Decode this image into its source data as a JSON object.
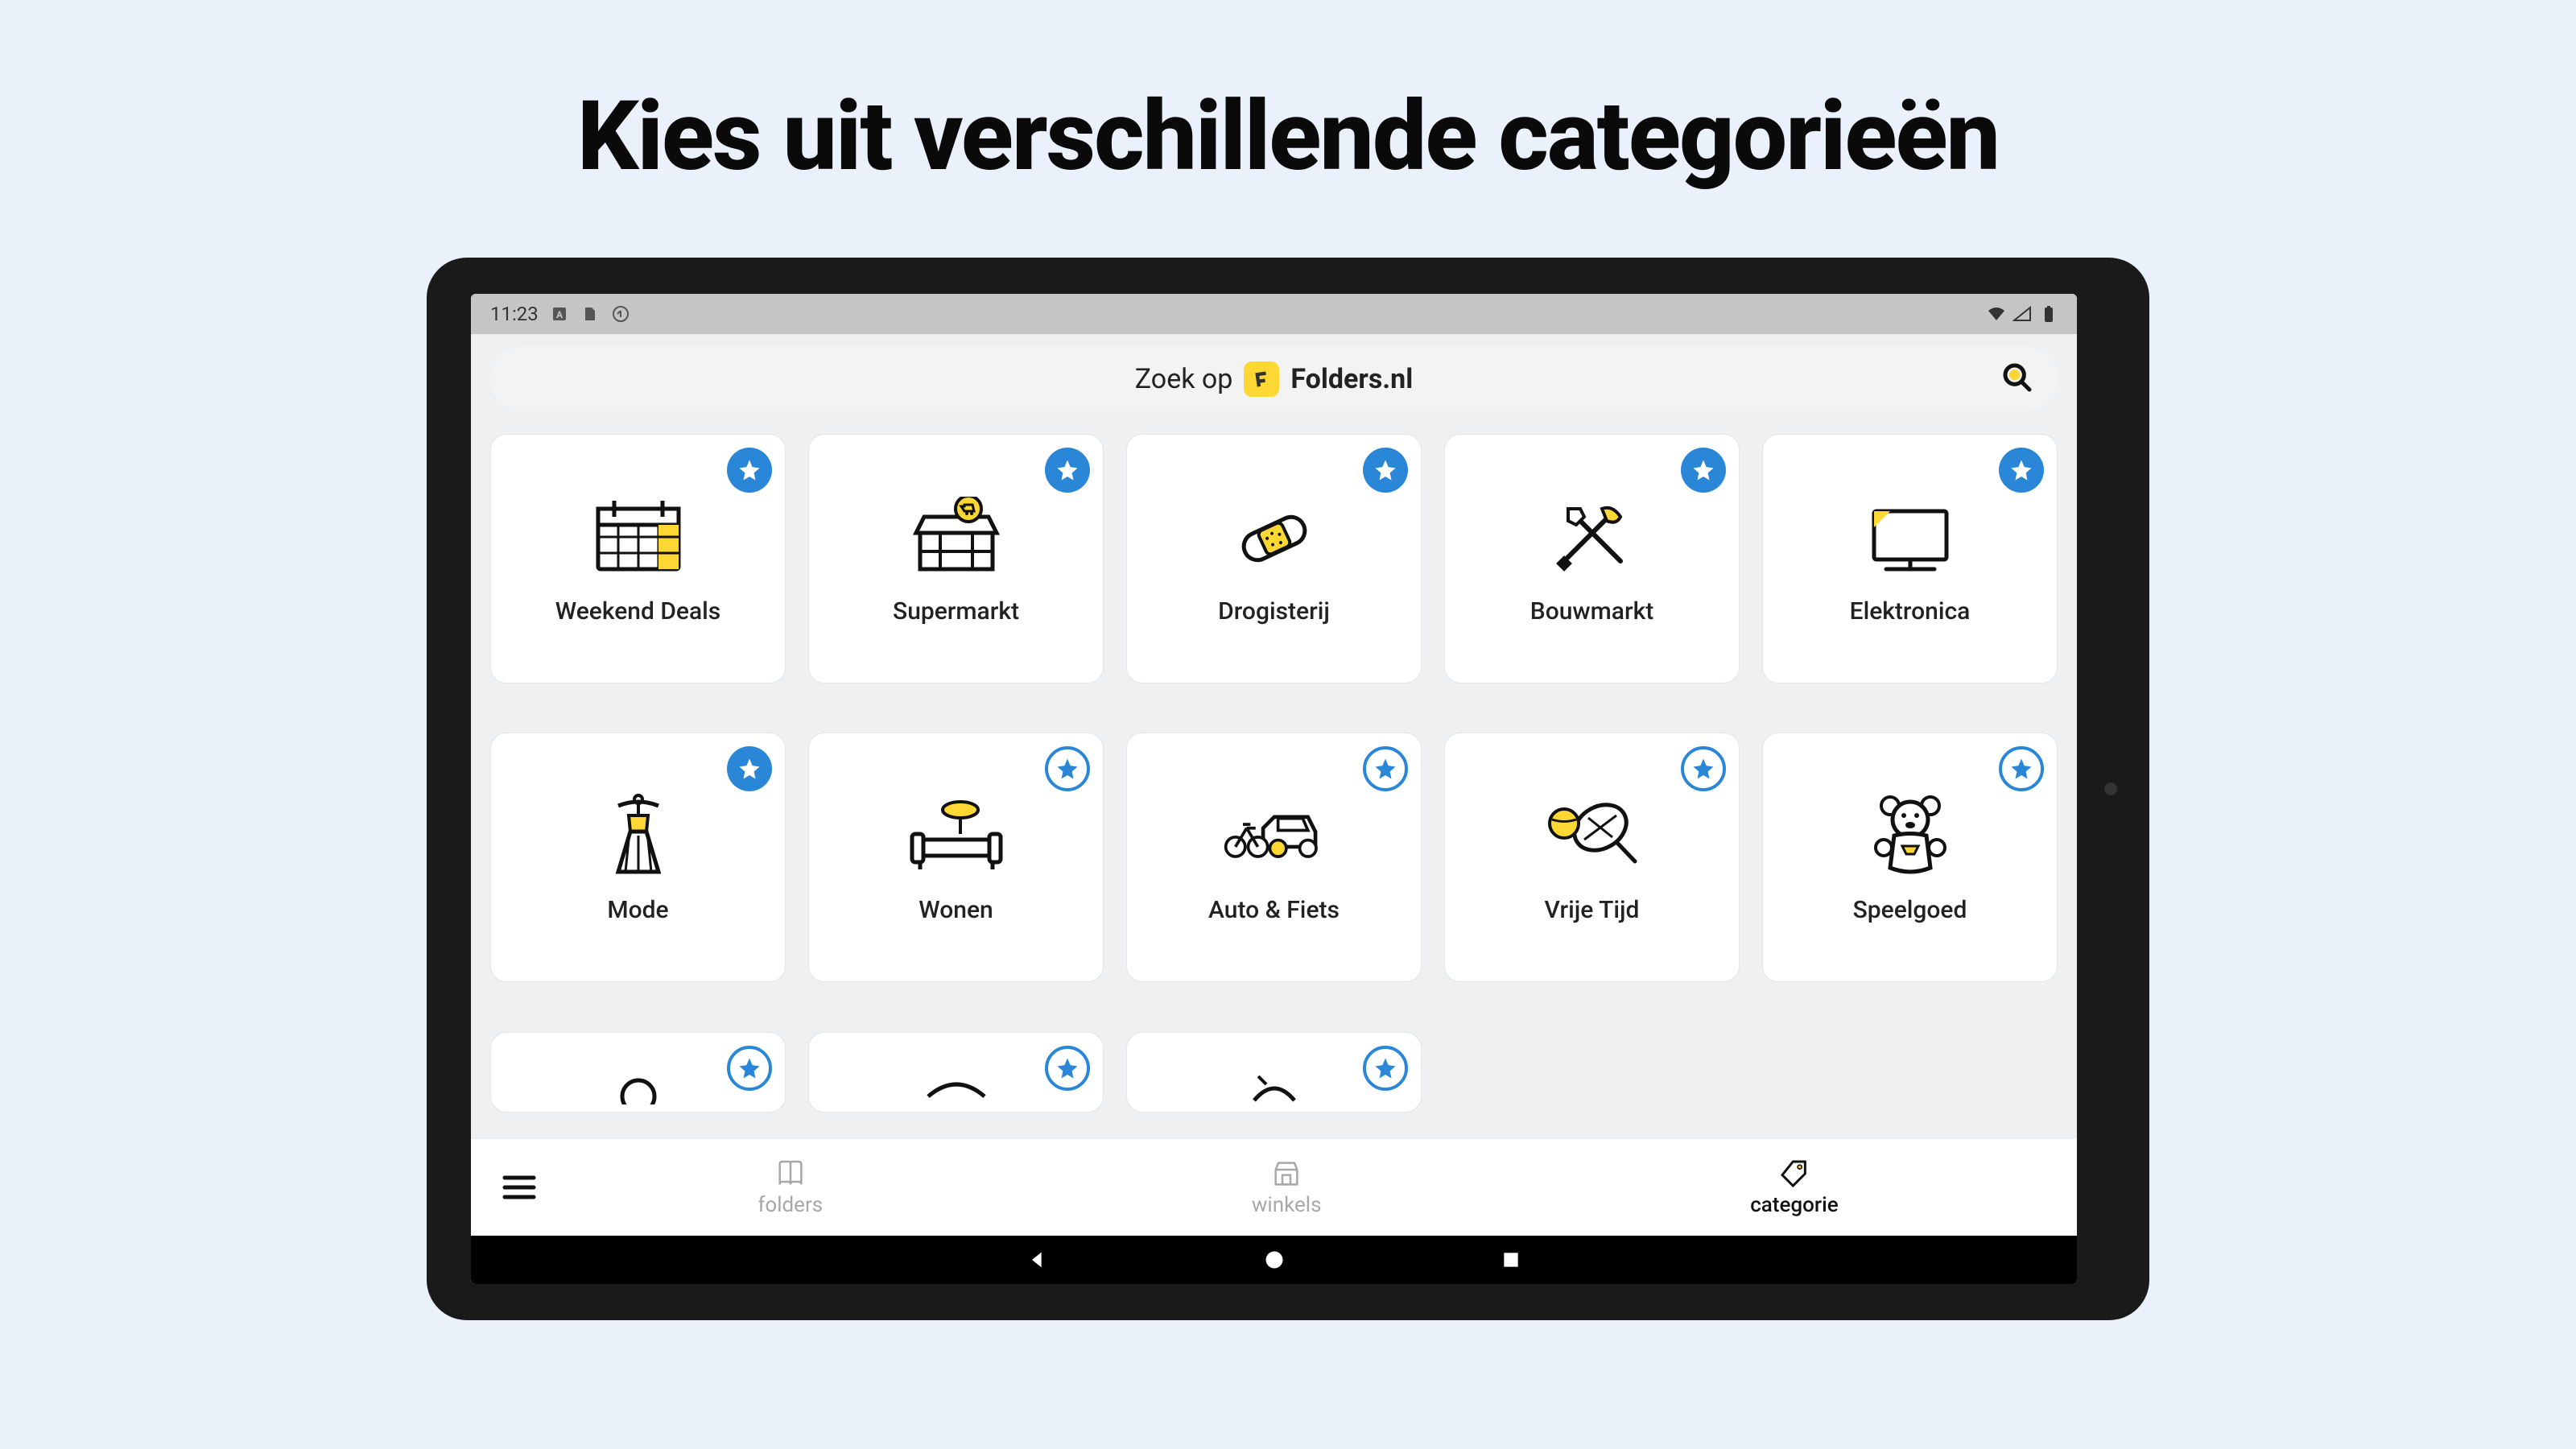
{
  "headline": "Kies uit verschillende categorieën",
  "status": {
    "time": "11:23"
  },
  "search": {
    "prefix": "Zoek op",
    "brand": "Folders.nl"
  },
  "categories": [
    {
      "label": "Weekend Deals",
      "icon": "calendar",
      "star_filled": true
    },
    {
      "label": "Supermarkt",
      "icon": "store",
      "star_filled": true
    },
    {
      "label": "Drogisterij",
      "icon": "bandage",
      "star_filled": true
    },
    {
      "label": "Bouwmarkt",
      "icon": "tools",
      "star_filled": true
    },
    {
      "label": "Elektronica",
      "icon": "tv",
      "star_filled": true
    },
    {
      "label": "Mode",
      "icon": "dress",
      "star_filled": true
    },
    {
      "label": "Wonen",
      "icon": "sofa",
      "star_filled": false
    },
    {
      "label": "Auto & Fiets",
      "icon": "car",
      "star_filled": false
    },
    {
      "label": "Vrije Tijd",
      "icon": "sports",
      "star_filled": false
    },
    {
      "label": "Speelgoed",
      "icon": "teddy",
      "star_filled": false
    },
    {
      "label": "",
      "icon": "",
      "star_filled": false
    },
    {
      "label": "",
      "icon": "",
      "star_filled": false
    },
    {
      "label": "",
      "icon": "",
      "star_filled": false
    }
  ],
  "nav": {
    "items": [
      {
        "label": "folders",
        "active": false
      },
      {
        "label": "winkels",
        "active": false
      },
      {
        "label": "categorie",
        "active": true
      }
    ]
  }
}
